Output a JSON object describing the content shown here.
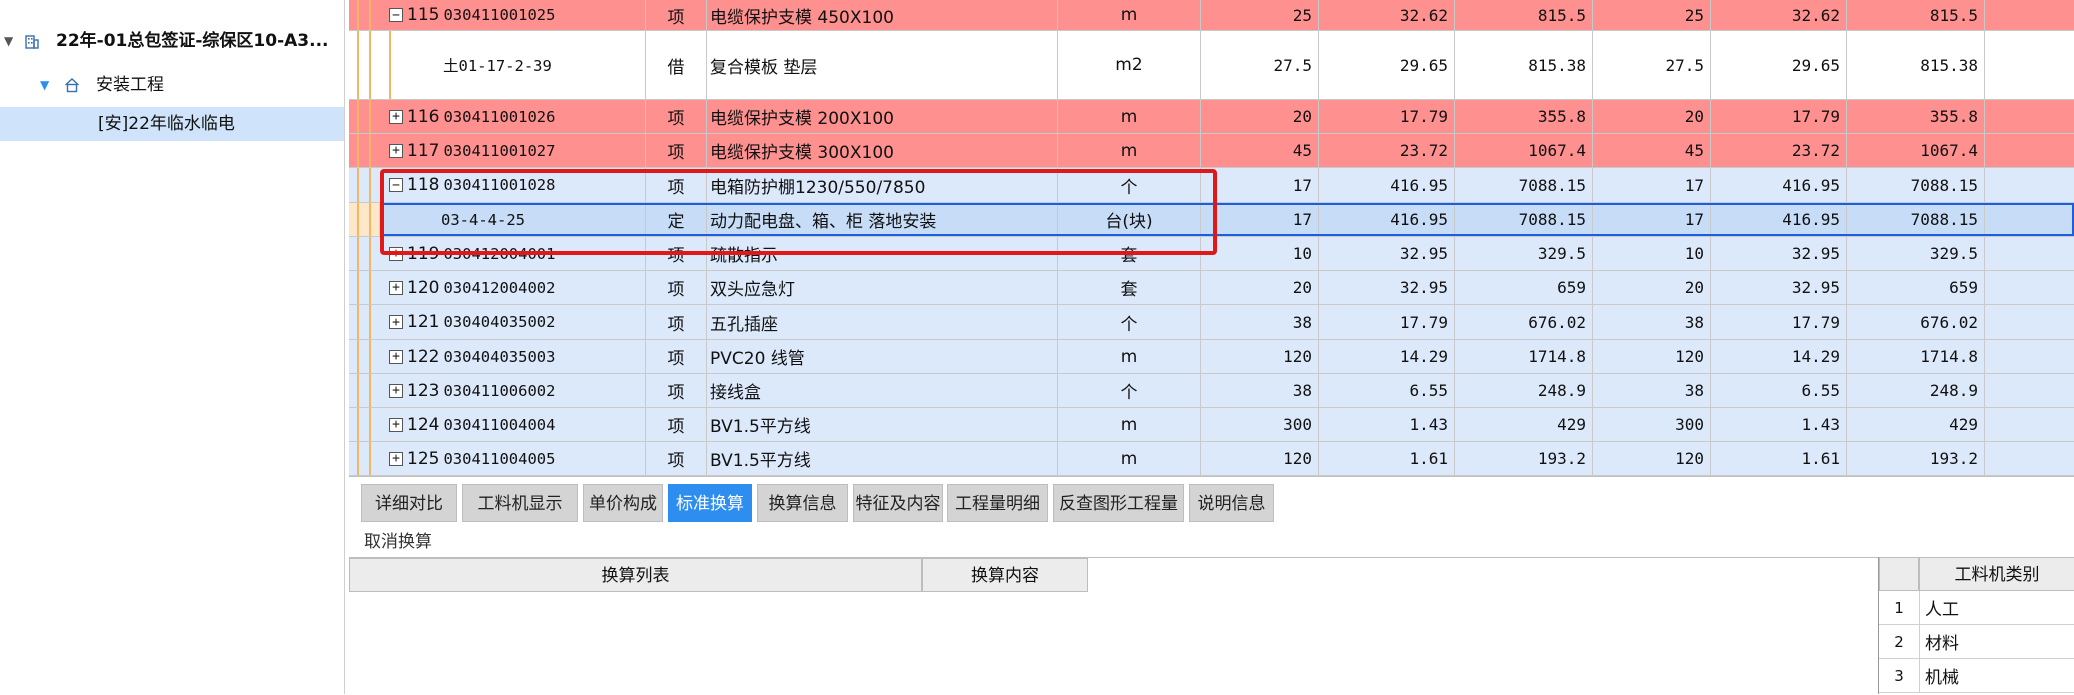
{
  "tree": {
    "project": "22年-01总包签证-综保区10-A3...",
    "unit": "安装工程",
    "item": "[安]22年临水临电"
  },
  "rows": [
    {
      "style": "red",
      "exp": "−",
      "no": "115",
      "code": "030411001025",
      "type": "项",
      "name": "电缆保护支模 450X100",
      "unit": "m",
      "q1": "25",
      "p1": "32.62",
      "t1": "815.5",
      "q2": "25",
      "p2": "32.62",
      "t2": "815.5"
    },
    {
      "style": "white",
      "exp": "",
      "no": "",
      "code": "土01-17-2-39",
      "type": "借",
      "name": "复合模板 垫层",
      "unit": "m2",
      "q1": "27.5",
      "p1": "29.65",
      "t1": "815.38",
      "q2": "27.5",
      "p2": "29.65",
      "t2": "815.38"
    },
    {
      "style": "red",
      "exp": "+",
      "no": "116",
      "code": "030411001026",
      "type": "项",
      "name": "电缆保护支模 200X100",
      "unit": "m",
      "q1": "20",
      "p1": "17.79",
      "t1": "355.8",
      "q2": "20",
      "p2": "17.79",
      "t2": "355.8"
    },
    {
      "style": "red",
      "exp": "+",
      "no": "117",
      "code": "030411001027",
      "type": "项",
      "name": "电缆保护支模 300X100",
      "unit": "m",
      "q1": "45",
      "p1": "23.72",
      "t1": "1067.4",
      "q2": "45",
      "p2": "23.72",
      "t2": "1067.4"
    },
    {
      "style": "blue",
      "exp": "−",
      "no": "118",
      "code": "030411001028",
      "type": "项",
      "name": "电箱防护棚1230/550/7850",
      "unit": "个",
      "q1": "17",
      "p1": "416.95",
      "t1": "7088.15",
      "q2": "17",
      "p2": "416.95",
      "t2": "7088.15"
    },
    {
      "style": "selected",
      "exp": "",
      "no": "",
      "code": "03-4-4-25",
      "type": "定",
      "name": "动力配电盘、箱、柜 落地安装",
      "unit": "台(块)",
      "q1": "17",
      "p1": "416.95",
      "t1": "7088.15",
      "q2": "17",
      "p2": "416.95",
      "t2": "7088.15"
    },
    {
      "style": "blue",
      "exp": "+",
      "no": "119",
      "code": "030412004001",
      "type": "项",
      "name": "疏散指示",
      "unit": "套",
      "q1": "10",
      "p1": "32.95",
      "t1": "329.5",
      "q2": "10",
      "p2": "32.95",
      "t2": "329.5"
    },
    {
      "style": "blue",
      "exp": "+",
      "no": "120",
      "code": "030412004002",
      "type": "项",
      "name": "双头应急灯",
      "unit": "套",
      "q1": "20",
      "p1": "32.95",
      "t1": "659",
      "q2": "20",
      "p2": "32.95",
      "t2": "659"
    },
    {
      "style": "blue",
      "exp": "+",
      "no": "121",
      "code": "030404035002",
      "type": "项",
      "name": "五孔插座",
      "unit": "个",
      "q1": "38",
      "p1": "17.79",
      "t1": "676.02",
      "q2": "38",
      "p2": "17.79",
      "t2": "676.02"
    },
    {
      "style": "blue",
      "exp": "+",
      "no": "122",
      "code": "030404035003",
      "type": "项",
      "name": "PVC20 线管",
      "unit": "m",
      "q1": "120",
      "p1": "14.29",
      "t1": "1714.8",
      "q2": "120",
      "p2": "14.29",
      "t2": "1714.8"
    },
    {
      "style": "blue",
      "exp": "+",
      "no": "123",
      "code": "030411006002",
      "type": "项",
      "name": "接线盒",
      "unit": "个",
      "q1": "38",
      "p1": "6.55",
      "t1": "248.9",
      "q2": "38",
      "p2": "6.55",
      "t2": "248.9"
    },
    {
      "style": "blue",
      "exp": "+",
      "no": "124",
      "code": "030411004004",
      "type": "项",
      "name": "BV1.5平方线",
      "unit": "m",
      "q1": "300",
      "p1": "1.43",
      "t1": "429",
      "q2": "300",
      "p2": "1.43",
      "t2": "429"
    },
    {
      "style": "blue",
      "exp": "+",
      "no": "125",
      "code": "030411004005",
      "type": "项",
      "name": "BV1.5平方线",
      "unit": "m",
      "q1": "120",
      "p1": "1.61",
      "t1": "193.2",
      "q2": "120",
      "p2": "1.61",
      "t2": "193.2"
    }
  ],
  "tabs": [
    "详细对比",
    "工料机显示",
    "单价构成",
    "标准换算",
    "换算信息",
    "特征及内容",
    "工程量明细",
    "反查图形工程量",
    "说明信息"
  ],
  "active_tab": "标准换算",
  "cancel_label": "取消换算",
  "lower_headers": {
    "list": "换算列表",
    "content": "换算内容"
  },
  "right_table": {
    "header": "工料机类别",
    "rows": [
      {
        "idx": "1",
        "label": "人工"
      },
      {
        "idx": "2",
        "label": "材料"
      },
      {
        "idx": "3",
        "label": "机械"
      }
    ]
  },
  "colors": {
    "red_row": "#ff9090",
    "blue_row": "#dce9fb",
    "selected_row": "#c6dcf7",
    "active_tab": "#2e8ef0",
    "highlight_box": "#e01818"
  }
}
